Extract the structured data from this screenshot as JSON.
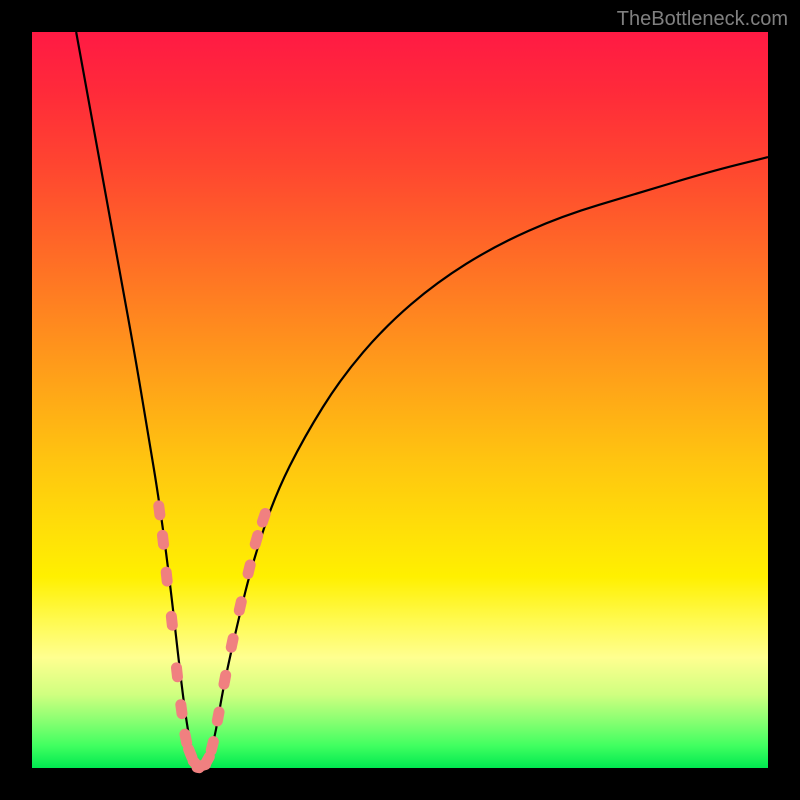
{
  "watermark": "TheBottleneck.com",
  "chart_data": {
    "type": "line",
    "title": "",
    "xlabel": "",
    "ylabel": "",
    "xlim": [
      0,
      100
    ],
    "ylim": [
      0,
      100
    ],
    "series": [
      {
        "name": "curve",
        "x": [
          6,
          8,
          10,
          12,
          14,
          16,
          17,
          18,
          19,
          20,
          21,
          22,
          23,
          24,
          25,
          26,
          28,
          30,
          33,
          37,
          42,
          48,
          55,
          63,
          72,
          82,
          92,
          100
        ],
        "values": [
          100,
          89,
          78,
          67,
          56,
          44,
          38,
          31,
          23,
          14,
          6,
          1,
          0,
          1,
          5,
          11,
          20,
          28,
          37,
          45,
          53,
          60,
          66,
          71,
          75,
          78,
          81,
          83
        ]
      }
    ],
    "scatter_points": {
      "name": "markers",
      "points": [
        {
          "x": 17.3,
          "y": 35
        },
        {
          "x": 17.8,
          "y": 31
        },
        {
          "x": 18.3,
          "y": 26
        },
        {
          "x": 19.0,
          "y": 20
        },
        {
          "x": 19.7,
          "y": 13
        },
        {
          "x": 20.3,
          "y": 8
        },
        {
          "x": 20.9,
          "y": 4
        },
        {
          "x": 21.5,
          "y": 2
        },
        {
          "x": 22.3,
          "y": 0.5
        },
        {
          "x": 23.0,
          "y": 0.3
        },
        {
          "x": 23.8,
          "y": 1
        },
        {
          "x": 24.5,
          "y": 3
        },
        {
          "x": 25.3,
          "y": 7
        },
        {
          "x": 26.2,
          "y": 12
        },
        {
          "x": 27.2,
          "y": 17
        },
        {
          "x": 28.3,
          "y": 22
        },
        {
          "x": 29.5,
          "y": 27
        },
        {
          "x": 30.5,
          "y": 31
        },
        {
          "x": 31.5,
          "y": 34
        }
      ]
    },
    "colors": {
      "curve": "#000000",
      "markers": "#f08080",
      "gradient_top": "#ff1a44",
      "gradient_bottom": "#00e850"
    }
  }
}
